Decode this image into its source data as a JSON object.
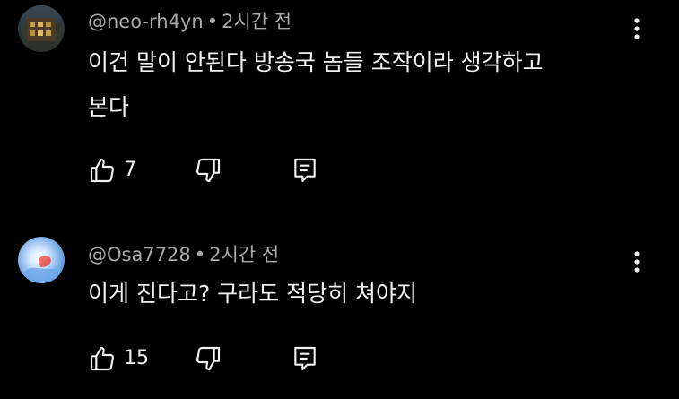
{
  "comments": [
    {
      "author": "@neo-rh4yn",
      "separator": "•",
      "time": "2시간 전",
      "lines": [
        "이건 말이 안된다 방송국 놈들 조작이라 생각하고",
        "본다"
      ],
      "likes": "7",
      "avatar_icon": "building-photo-avatar"
    },
    {
      "author": "@Osa7728",
      "separator": "•",
      "time": "2시간 전",
      "lines": [
        "이게 진다고? 구라도 적당히 쳐야지"
      ],
      "likes": "15",
      "avatar_icon": "blue-red-photo-avatar"
    }
  ],
  "icons": {
    "like": "thumbs-up-icon",
    "dislike": "thumbs-down-icon",
    "reply": "reply-icon",
    "more": "kebab-menu-icon"
  },
  "colors": {
    "background": "#000000",
    "text": "#f1f1f1",
    "meta": "#aaaaaa"
  }
}
